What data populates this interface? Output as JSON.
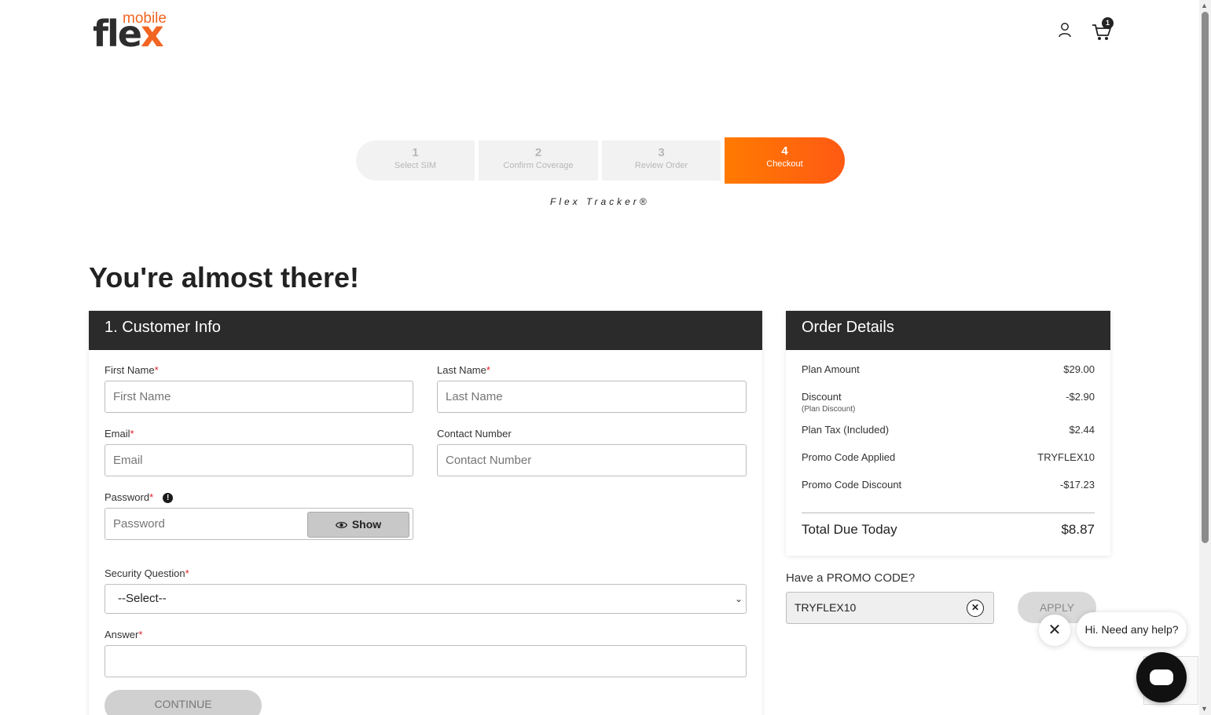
{
  "brand": {
    "logo_main": "fle",
    "logo_x": "x",
    "logo_sub": "mobile"
  },
  "header": {
    "cart_count": "1"
  },
  "stepper": {
    "steps": [
      {
        "num": "1",
        "label": "Select SIM"
      },
      {
        "num": "2",
        "label": "Confirm Coverage"
      },
      {
        "num": "3",
        "label": "Review Order"
      },
      {
        "num": "4",
        "label": "Checkout"
      }
    ],
    "tracker_label": "Flex Tracker®",
    "active_step": "4"
  },
  "headline": "You're almost there!",
  "customer_info": {
    "title": "1. Customer Info",
    "first_name": {
      "label": "First Name",
      "placeholder": "First Name"
    },
    "last_name": {
      "label": "Last Name",
      "placeholder": "Last Name"
    },
    "email": {
      "label": "Email",
      "placeholder": "Email"
    },
    "contact": {
      "label": "Contact Number",
      "placeholder": "Contact Number"
    },
    "password": {
      "label": "Password",
      "placeholder": "Password",
      "show_label": "Show"
    },
    "security_question": {
      "label": "Security Question",
      "selected": "--Select--"
    },
    "answer": {
      "label": "Answer",
      "value": ""
    },
    "required_mark": "*",
    "continue_label": "CONTINUE"
  },
  "order": {
    "title": "Order Details",
    "rows": [
      {
        "label": "Plan Amount",
        "value": "$29.00"
      },
      {
        "label": "Discount",
        "sub": "(Plan Discount)",
        "value": "-$2.90"
      },
      {
        "label": "Plan Tax (Included)",
        "value": "$2.44"
      },
      {
        "label": "Promo Code Applied",
        "value": "TRYFLEX10"
      },
      {
        "label": "Promo Code Discount",
        "value": "-$17.23"
      }
    ],
    "total_label": "Total Due Today",
    "total_value": "$8.87"
  },
  "promo": {
    "label": "Have a PROMO CODE?",
    "value": "TRYFLEX10",
    "apply_label": "APPLY"
  },
  "chat": {
    "greeting": "Hi. Need any help?"
  },
  "colors": {
    "accent": "#ff6a0a",
    "header_bg": "#2b2b2b",
    "required": "#e0202a"
  }
}
